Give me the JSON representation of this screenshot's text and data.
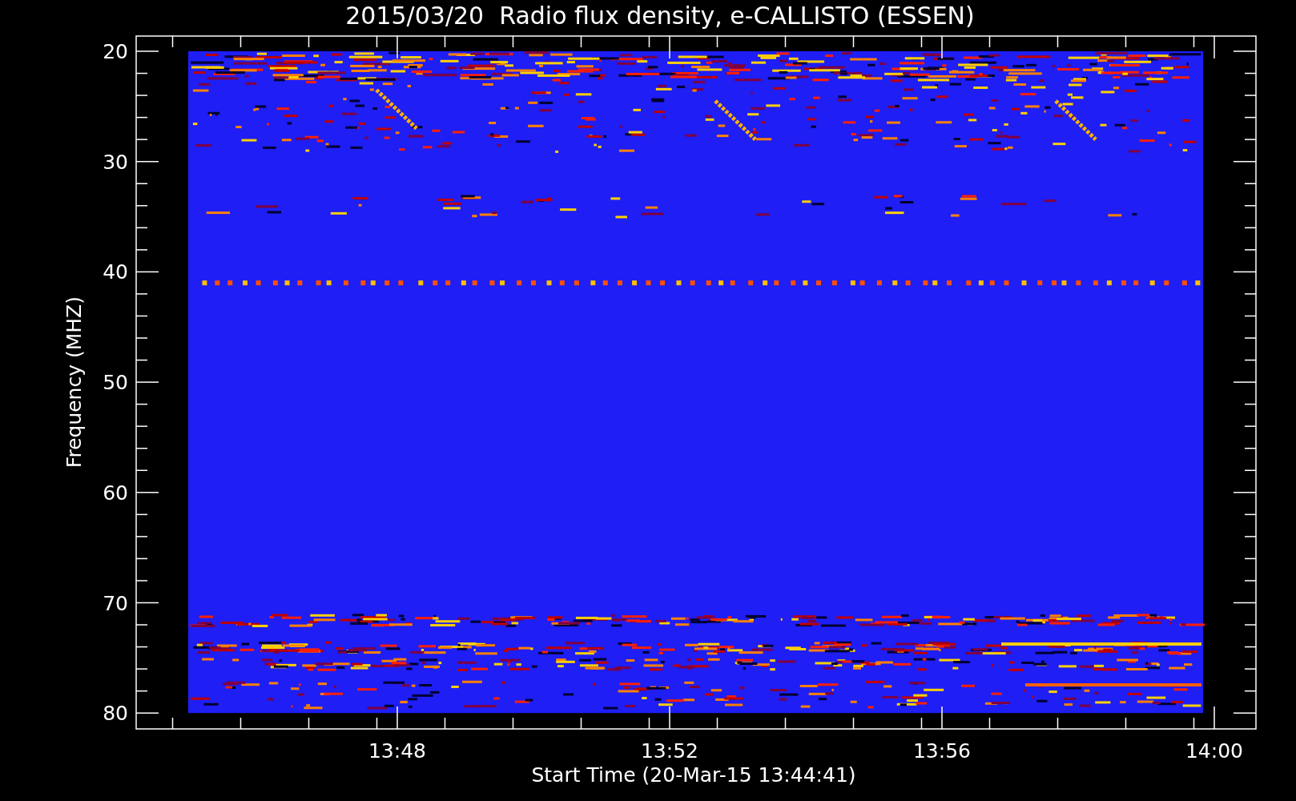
{
  "title": "2015/03/20  Radio flux density, e-CALLISTO (ESSEN)",
  "plot": {
    "ylabel": "Frequency (MHZ)",
    "xlabel": "Start Time (20-Mar-15 13:44:41)",
    "yticks": [
      "20",
      "30",
      "40",
      "50",
      "60",
      "70",
      "80"
    ],
    "xticks": [
      "13:48",
      "13:52",
      "13:56",
      "14:00"
    ]
  }
}
